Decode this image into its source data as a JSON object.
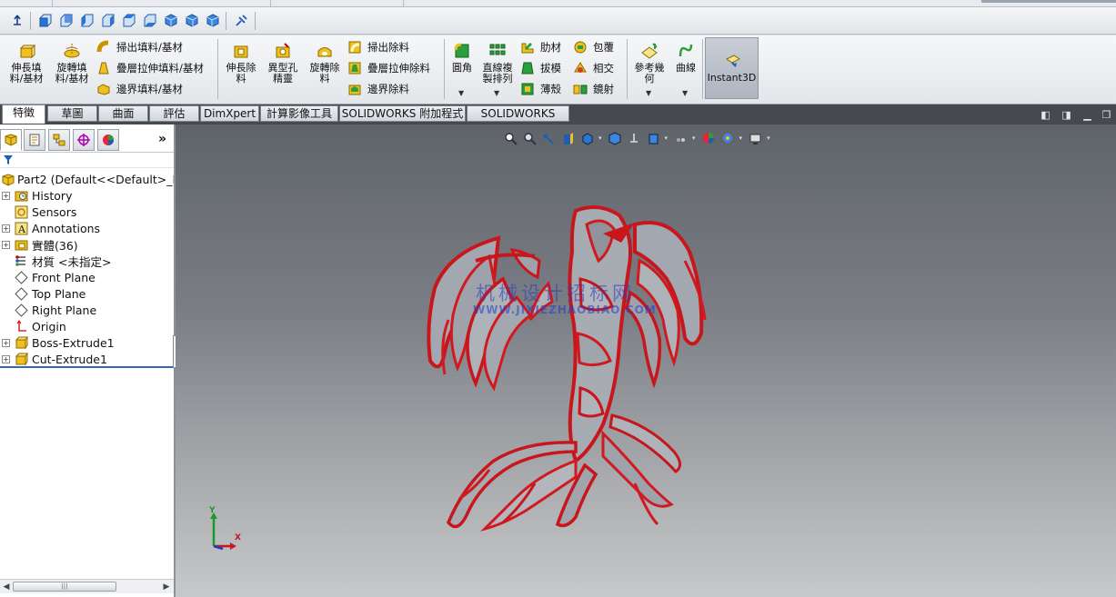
{
  "view_toolbar": {
    "icons": [
      "normal-to-icon",
      "front-view-icon",
      "back-view-icon",
      "left-view-icon",
      "right-view-icon",
      "top-view-icon",
      "bottom-view-icon",
      "isometric-view-icon",
      "trimetric-view-icon",
      "dimetric-view-icon",
      "link-view-icon"
    ]
  },
  "command_manager": {
    "group1": {
      "extruded_boss": "伸長填\n料/基材",
      "revolved_boss": "旋轉填\n料/基材",
      "swept_boss": "掃出填料/基材",
      "lofted_boss": "疊層拉伸填料/基材",
      "boundary_boss": "邊界填料/基材"
    },
    "group2": {
      "extruded_cut": "伸長除\n料",
      "hole_wizard": "異型孔\n精靈",
      "revolved_cut": "旋轉除\n料",
      "swept_cut": "掃出除料",
      "lofted_cut": "疊層拉伸除料",
      "boundary_cut": "邊界除料"
    },
    "group3": {
      "fillet": "圓角",
      "linear_pattern": "直線複\n製排列",
      "rib": "肋材",
      "draft": "拔模",
      "shell": "薄殼",
      "wrap": "包覆",
      "intersect": "相交",
      "mirror": "鏡射"
    },
    "group4": {
      "reference_geometry": "參考幾\n何",
      "curves": "曲線"
    },
    "instant3d": "Instant3D"
  },
  "tabs": [
    "特徵",
    "草圖",
    "曲面",
    "評估",
    "DimXpert",
    "計算影像工具",
    "SOLIDWORKS 附加程式",
    "SOLIDWORKS MBD"
  ],
  "active_tab": "特徵",
  "feature_tree": {
    "root": "Part2  (Default<<Default>_Disp",
    "items": [
      {
        "label": "History",
        "icon": "history-folder-icon",
        "expandable": true
      },
      {
        "label": "Sensors",
        "icon": "sensors-icon",
        "expandable": false
      },
      {
        "label": "Annotations",
        "icon": "annotations-icon",
        "expandable": true
      },
      {
        "label": "實體(36)",
        "icon": "solid-bodies-folder-icon",
        "expandable": true
      },
      {
        "label": "材質 <未指定>",
        "icon": "material-icon",
        "expandable": false
      },
      {
        "label": "Front Plane",
        "icon": "plane-icon",
        "expandable": false
      },
      {
        "label": "Top Plane",
        "icon": "plane-icon",
        "expandable": false
      },
      {
        "label": "Right Plane",
        "icon": "plane-icon",
        "expandable": false
      },
      {
        "label": "Origin",
        "icon": "origin-icon",
        "expandable": false
      },
      {
        "label": "Boss-Extrude1",
        "icon": "extrude-feature-icon",
        "expandable": true
      },
      {
        "label": "Cut-Extrude1",
        "icon": "extrude-feature-icon",
        "expandable": true
      }
    ]
  },
  "viewport": {
    "watermark_cn": "机械设计招标网",
    "watermark_url": "WWW.JIXIEZHAOBIAO.COM",
    "triad_x": "X",
    "triad_y": "Y",
    "colors": {
      "model_red": "#d01a1f",
      "model_gray": "#9ea3ab",
      "bg_top": "#5f636a",
      "bg_bottom": "#c7c8c9"
    }
  }
}
